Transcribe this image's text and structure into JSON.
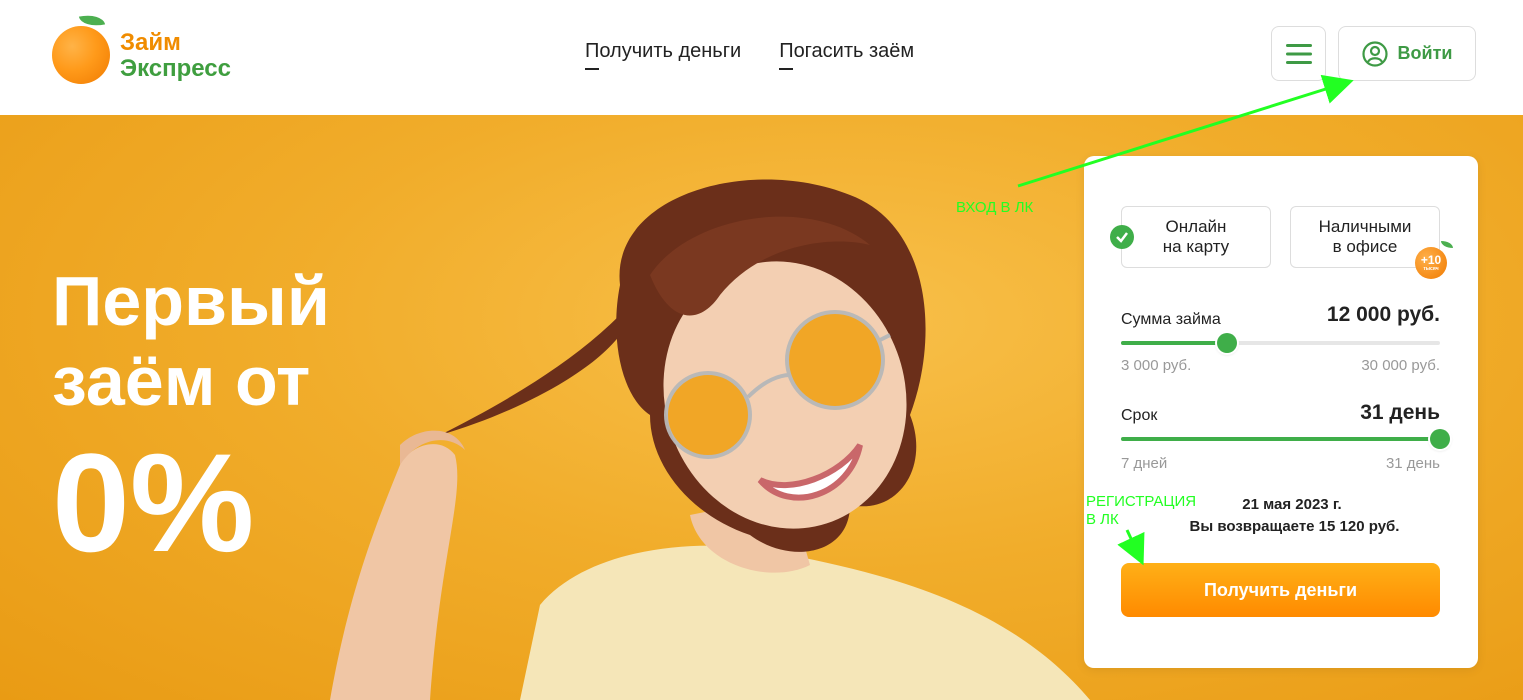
{
  "logo": {
    "line1": "Займ",
    "line2": "Экспресс"
  },
  "nav": {
    "get_money": "Получить деньги",
    "repay_loan": "Погасить заём"
  },
  "header": {
    "login_label": "Войти"
  },
  "hero": {
    "line1": "Первый",
    "line2": "заём от",
    "rate": "0%"
  },
  "annotations": {
    "login_note": "ВХОД В ЛК",
    "register_note_line1": "РЕГИСТРАЦИЯ",
    "register_note_line2": "В ЛК"
  },
  "calculator": {
    "option_online_line1": "Онлайн",
    "option_online_line2": "на карту",
    "option_cash_line1": "Наличными",
    "option_cash_line2": "в офисе",
    "bonus_badge": "+10",
    "bonus_badge_sub": "тысяч",
    "amount": {
      "label": "Сумма займа",
      "value_text": "12 000 руб.",
      "min_text": "3 000 руб.",
      "max_text": "30 000 руб.",
      "value": 12000,
      "min": 3000,
      "max": 30000
    },
    "term": {
      "label": "Срок",
      "value_text": "31 день",
      "min_text": "7 дней",
      "max_text": "31 день",
      "value": 31,
      "min": 7,
      "max": 31
    },
    "due_date": "21 мая 2023 г.",
    "return_text": "Вы возвращаете 15 120 руб.",
    "cta_label": "Получить деньги"
  },
  "colors": {
    "brand_green": "#3fae49",
    "brand_orange": "#f08c00",
    "hero_bg": "#f1ad2b",
    "annotation": "#22ff22"
  }
}
